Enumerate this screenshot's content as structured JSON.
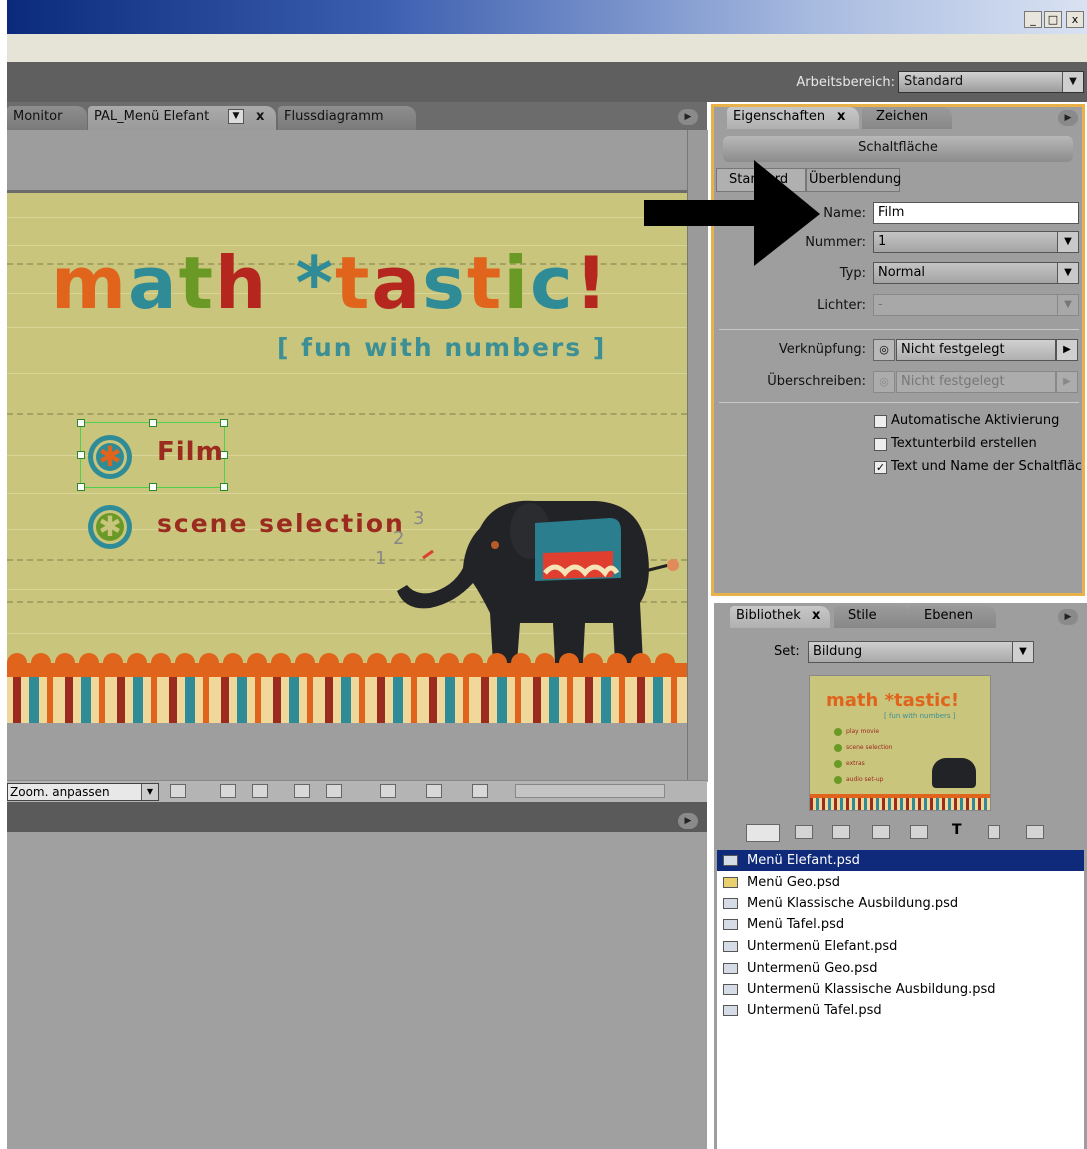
{
  "window": {
    "min": "_",
    "max": "□",
    "close": "x"
  },
  "workspace": {
    "label": "Arbeitsbereich:",
    "value": "Standard"
  },
  "left_tabs": [
    {
      "label": "Monitor"
    },
    {
      "label": "PAL_Menü Elefant"
    },
    {
      "label": "Flussdiagramm"
    }
  ],
  "tab_close": "x",
  "canvas": {
    "title_parts": [
      "m",
      "a",
      "t",
      "h",
      " ",
      "*",
      "t",
      "a",
      "s",
      "t",
      "i",
      "c",
      "!"
    ],
    "subtitle": "[ fun with numbers ]",
    "menu_items": [
      "Film",
      "scene selection"
    ],
    "numbers": [
      "1",
      "2",
      "3"
    ]
  },
  "statusbar": {
    "zoom": "Zoom. anpassen"
  },
  "properties": {
    "tabs": [
      "Eigenschaften",
      "Zeichen"
    ],
    "header": "Schaltfläche",
    "subtabs": [
      "Standard",
      "Überblendung"
    ],
    "name_label": "Name:",
    "name_value": "Film",
    "nummer_label": "Nummer:",
    "nummer_value": "1",
    "typ_label": "Typ:",
    "typ_value": "Normal",
    "lichter_label": "Lichter:",
    "lichter_value": "-",
    "verknuepfung_label": "Verknüpfung:",
    "verknuepfung_value": "Nicht festgelegt",
    "ueberschreiben_label": "Überschreiben:",
    "ueberschreiben_value": "Nicht festgelegt",
    "checkboxes": [
      {
        "label": "Automatische Aktivierung",
        "checked": false
      },
      {
        "label": "Textunterbild erstellen",
        "checked": false
      },
      {
        "label": "Text und Name der Schaltfläc",
        "checked": true
      }
    ]
  },
  "library": {
    "tabs": [
      "Bibliothek",
      "Stile",
      "Ebenen"
    ],
    "set_label": "Set:",
    "set_value": "Bildung",
    "thumb": {
      "title": "math *tastic!",
      "subtitle": "[ fun with numbers ]",
      "items": [
        "play movie",
        "scene selection",
        "extras",
        "audio set-up"
      ]
    },
    "items": [
      "Menü Elefant.psd",
      "Menü Geo.psd",
      "Menü Klassische Ausbildung.psd",
      "Menü Tafel.psd",
      "Untermenü Elefant.psd",
      "Untermenü Geo.psd",
      "Untermenü Klassische Ausbildung.psd",
      "Untermenü Tafel.psd"
    ],
    "selected_index": 0
  },
  "colors": {
    "selection": "#0f2a7a",
    "panel_highlight": "#e8b14a",
    "canvas_bg": "#c9c57c",
    "title_orange": "#e0641c",
    "title_teal": "#2f8c96",
    "title_green": "#6a9a25",
    "title_red": "#b5261e",
    "subtitle": "#3c8f95",
    "menu_text": "#9b2a1f"
  }
}
